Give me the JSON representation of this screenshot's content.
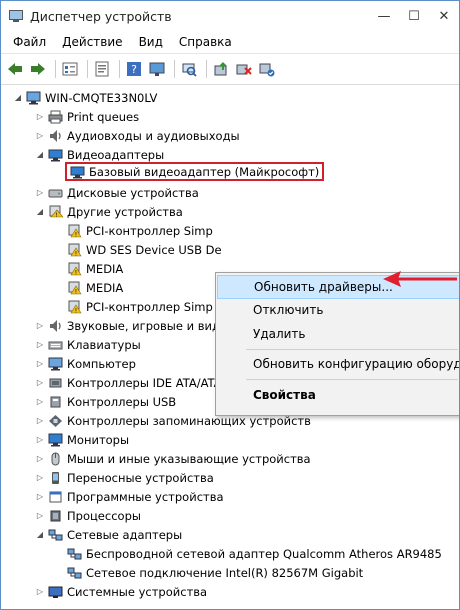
{
  "window": {
    "title": "Диспетчер устройств"
  },
  "menu": [
    "Файл",
    "Действие",
    "Вид",
    "Справка"
  ],
  "tree": {
    "root": "WIN-CMQTE33N0LV",
    "items": [
      "Print queues",
      "Аудиовходы и аудиовыходы",
      "Видеоадаптеры",
      "Базовый видеоадаптер (Майкрософт)",
      "Дисковые устройства",
      "Другие устройства",
      "PCI-контроллер Simp",
      "WD SES Device USB De",
      "MEDIA",
      "MEDIA",
      "PCI-контроллер Simp",
      "Звуковые, игровые и видеоустройства",
      "Клавиатуры",
      "Компьютер",
      "Контроллеры IDE ATA/ATAPI",
      "Контроллеры USB",
      "Контроллеры запоминающих устройств",
      "Мониторы",
      "Мыши и иные указывающие устройства",
      "Переносные устройства",
      "Программные устройства",
      "Процессоры",
      "Сетевые адаптеры",
      "Беспроводной сетевой адаптер Qualcomm Atheros AR9485",
      "Сетевое подключение Intel(R) 82567M Gigabit",
      "Системные устройства"
    ]
  },
  "context_menu": {
    "update": "Обновить драйверы...",
    "disable": "Отключить",
    "delete": "Удалить",
    "scan": "Обновить конфигурацию оборудования",
    "properties": "Свойства"
  },
  "colors": {
    "highlight_border": "#d0202c",
    "arrow": "#e02030",
    "menu_highlight": "#cde8ff"
  }
}
